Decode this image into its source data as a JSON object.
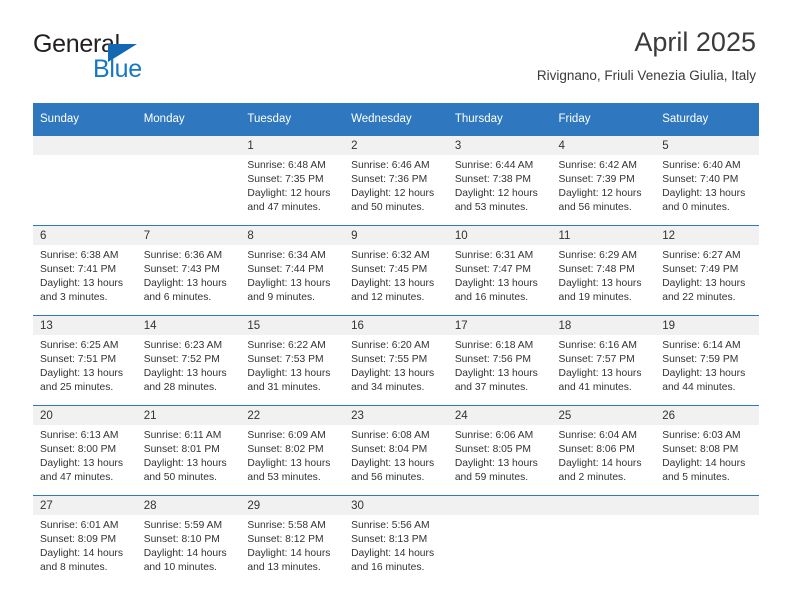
{
  "brand": {
    "name_part1": "General",
    "name_part2": "Blue"
  },
  "header": {
    "title": "April 2025",
    "subtitle": "Rivignano, Friuli Venezia Giulia, Italy"
  },
  "colors": {
    "header_blue": "#2f78bf",
    "brand_blue": "#1877c4",
    "daynum_band": "#f1f1f1",
    "text": "#333333"
  },
  "weekday_headers": [
    "Sunday",
    "Monday",
    "Tuesday",
    "Wednesday",
    "Thursday",
    "Friday",
    "Saturday"
  ],
  "weeks": [
    [
      {
        "day": "",
        "sunrise": "",
        "sunset": "",
        "daylight_line1": "",
        "daylight_line2": ""
      },
      {
        "day": "",
        "sunrise": "",
        "sunset": "",
        "daylight_line1": "",
        "daylight_line2": ""
      },
      {
        "day": "1",
        "sunrise": "Sunrise: 6:48 AM",
        "sunset": "Sunset: 7:35 PM",
        "daylight_line1": "Daylight: 12 hours",
        "daylight_line2": "and 47 minutes."
      },
      {
        "day": "2",
        "sunrise": "Sunrise: 6:46 AM",
        "sunset": "Sunset: 7:36 PM",
        "daylight_line1": "Daylight: 12 hours",
        "daylight_line2": "and 50 minutes."
      },
      {
        "day": "3",
        "sunrise": "Sunrise: 6:44 AM",
        "sunset": "Sunset: 7:38 PM",
        "daylight_line1": "Daylight: 12 hours",
        "daylight_line2": "and 53 minutes."
      },
      {
        "day": "4",
        "sunrise": "Sunrise: 6:42 AM",
        "sunset": "Sunset: 7:39 PM",
        "daylight_line1": "Daylight: 12 hours",
        "daylight_line2": "and 56 minutes."
      },
      {
        "day": "5",
        "sunrise": "Sunrise: 6:40 AM",
        "sunset": "Sunset: 7:40 PM",
        "daylight_line1": "Daylight: 13 hours",
        "daylight_line2": "and 0 minutes."
      }
    ],
    [
      {
        "day": "6",
        "sunrise": "Sunrise: 6:38 AM",
        "sunset": "Sunset: 7:41 PM",
        "daylight_line1": "Daylight: 13 hours",
        "daylight_line2": "and 3 minutes."
      },
      {
        "day": "7",
        "sunrise": "Sunrise: 6:36 AM",
        "sunset": "Sunset: 7:43 PM",
        "daylight_line1": "Daylight: 13 hours",
        "daylight_line2": "and 6 minutes."
      },
      {
        "day": "8",
        "sunrise": "Sunrise: 6:34 AM",
        "sunset": "Sunset: 7:44 PM",
        "daylight_line1": "Daylight: 13 hours",
        "daylight_line2": "and 9 minutes."
      },
      {
        "day": "9",
        "sunrise": "Sunrise: 6:32 AM",
        "sunset": "Sunset: 7:45 PM",
        "daylight_line1": "Daylight: 13 hours",
        "daylight_line2": "and 12 minutes."
      },
      {
        "day": "10",
        "sunrise": "Sunrise: 6:31 AM",
        "sunset": "Sunset: 7:47 PM",
        "daylight_line1": "Daylight: 13 hours",
        "daylight_line2": "and 16 minutes."
      },
      {
        "day": "11",
        "sunrise": "Sunrise: 6:29 AM",
        "sunset": "Sunset: 7:48 PM",
        "daylight_line1": "Daylight: 13 hours",
        "daylight_line2": "and 19 minutes."
      },
      {
        "day": "12",
        "sunrise": "Sunrise: 6:27 AM",
        "sunset": "Sunset: 7:49 PM",
        "daylight_line1": "Daylight: 13 hours",
        "daylight_line2": "and 22 minutes."
      }
    ],
    [
      {
        "day": "13",
        "sunrise": "Sunrise: 6:25 AM",
        "sunset": "Sunset: 7:51 PM",
        "daylight_line1": "Daylight: 13 hours",
        "daylight_line2": "and 25 minutes."
      },
      {
        "day": "14",
        "sunrise": "Sunrise: 6:23 AM",
        "sunset": "Sunset: 7:52 PM",
        "daylight_line1": "Daylight: 13 hours",
        "daylight_line2": "and 28 minutes."
      },
      {
        "day": "15",
        "sunrise": "Sunrise: 6:22 AM",
        "sunset": "Sunset: 7:53 PM",
        "daylight_line1": "Daylight: 13 hours",
        "daylight_line2": "and 31 minutes."
      },
      {
        "day": "16",
        "sunrise": "Sunrise: 6:20 AM",
        "sunset": "Sunset: 7:55 PM",
        "daylight_line1": "Daylight: 13 hours",
        "daylight_line2": "and 34 minutes."
      },
      {
        "day": "17",
        "sunrise": "Sunrise: 6:18 AM",
        "sunset": "Sunset: 7:56 PM",
        "daylight_line1": "Daylight: 13 hours",
        "daylight_line2": "and 37 minutes."
      },
      {
        "day": "18",
        "sunrise": "Sunrise: 6:16 AM",
        "sunset": "Sunset: 7:57 PM",
        "daylight_line1": "Daylight: 13 hours",
        "daylight_line2": "and 41 minutes."
      },
      {
        "day": "19",
        "sunrise": "Sunrise: 6:14 AM",
        "sunset": "Sunset: 7:59 PM",
        "daylight_line1": "Daylight: 13 hours",
        "daylight_line2": "and 44 minutes."
      }
    ],
    [
      {
        "day": "20",
        "sunrise": "Sunrise: 6:13 AM",
        "sunset": "Sunset: 8:00 PM",
        "daylight_line1": "Daylight: 13 hours",
        "daylight_line2": "and 47 minutes."
      },
      {
        "day": "21",
        "sunrise": "Sunrise: 6:11 AM",
        "sunset": "Sunset: 8:01 PM",
        "daylight_line1": "Daylight: 13 hours",
        "daylight_line2": "and 50 minutes."
      },
      {
        "day": "22",
        "sunrise": "Sunrise: 6:09 AM",
        "sunset": "Sunset: 8:02 PM",
        "daylight_line1": "Daylight: 13 hours",
        "daylight_line2": "and 53 minutes."
      },
      {
        "day": "23",
        "sunrise": "Sunrise: 6:08 AM",
        "sunset": "Sunset: 8:04 PM",
        "daylight_line1": "Daylight: 13 hours",
        "daylight_line2": "and 56 minutes."
      },
      {
        "day": "24",
        "sunrise": "Sunrise: 6:06 AM",
        "sunset": "Sunset: 8:05 PM",
        "daylight_line1": "Daylight: 13 hours",
        "daylight_line2": "and 59 minutes."
      },
      {
        "day": "25",
        "sunrise": "Sunrise: 6:04 AM",
        "sunset": "Sunset: 8:06 PM",
        "daylight_line1": "Daylight: 14 hours",
        "daylight_line2": "and 2 minutes."
      },
      {
        "day": "26",
        "sunrise": "Sunrise: 6:03 AM",
        "sunset": "Sunset: 8:08 PM",
        "daylight_line1": "Daylight: 14 hours",
        "daylight_line2": "and 5 minutes."
      }
    ],
    [
      {
        "day": "27",
        "sunrise": "Sunrise: 6:01 AM",
        "sunset": "Sunset: 8:09 PM",
        "daylight_line1": "Daylight: 14 hours",
        "daylight_line2": "and 8 minutes."
      },
      {
        "day": "28",
        "sunrise": "Sunrise: 5:59 AM",
        "sunset": "Sunset: 8:10 PM",
        "daylight_line1": "Daylight: 14 hours",
        "daylight_line2": "and 10 minutes."
      },
      {
        "day": "29",
        "sunrise": "Sunrise: 5:58 AM",
        "sunset": "Sunset: 8:12 PM",
        "daylight_line1": "Daylight: 14 hours",
        "daylight_line2": "and 13 minutes."
      },
      {
        "day": "30",
        "sunrise": "Sunrise: 5:56 AM",
        "sunset": "Sunset: 8:13 PM",
        "daylight_line1": "Daylight: 14 hours",
        "daylight_line2": "and 16 minutes."
      },
      {
        "day": "",
        "sunrise": "",
        "sunset": "",
        "daylight_line1": "",
        "daylight_line2": ""
      },
      {
        "day": "",
        "sunrise": "",
        "sunset": "",
        "daylight_line1": "",
        "daylight_line2": ""
      },
      {
        "day": "",
        "sunrise": "",
        "sunset": "",
        "daylight_line1": "",
        "daylight_line2": ""
      }
    ]
  ]
}
